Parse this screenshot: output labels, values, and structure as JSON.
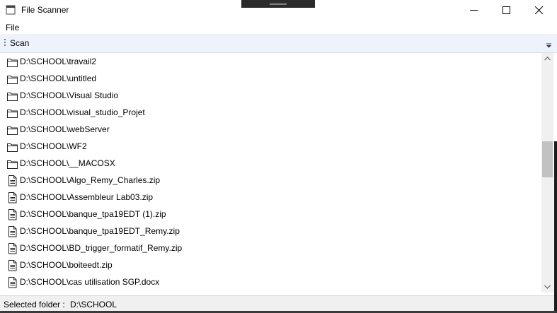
{
  "window": {
    "title": "File Scanner"
  },
  "menu": {
    "file": "File"
  },
  "toolbar": {
    "scan": "Scan"
  },
  "entries": [
    {
      "type": "folder",
      "path": "D:\\SCHOOL\\travail2"
    },
    {
      "type": "folder",
      "path": "D:\\SCHOOL\\untitled"
    },
    {
      "type": "folder",
      "path": "D:\\SCHOOL\\Visual Studio"
    },
    {
      "type": "folder",
      "path": "D:\\SCHOOL\\visual_studio_Projet"
    },
    {
      "type": "folder",
      "path": "D:\\SCHOOL\\webServer"
    },
    {
      "type": "folder",
      "path": "D:\\SCHOOL\\WF2"
    },
    {
      "type": "folder",
      "path": "D:\\SCHOOL\\__MACOSX"
    },
    {
      "type": "file",
      "path": "D:\\SCHOOL\\Algo_Remy_Charles.zip"
    },
    {
      "type": "file",
      "path": "D:\\SCHOOL\\Assembleur Lab03.zip"
    },
    {
      "type": "file",
      "path": "D:\\SCHOOL\\banque_tpa19EDT (1).zip"
    },
    {
      "type": "file",
      "path": "D:\\SCHOOL\\banque_tpa19EDT_Remy.zip"
    },
    {
      "type": "file",
      "path": "D:\\SCHOOL\\BD_trigger_formatif_Remy.zip"
    },
    {
      "type": "file",
      "path": "D:\\SCHOOL\\boiteedt.zip"
    },
    {
      "type": "file",
      "path": "D:\\SCHOOL\\cas utilisation SGP.docx"
    }
  ],
  "status": {
    "label": "Selected folder :",
    "value": "D:\\SCHOOL"
  }
}
